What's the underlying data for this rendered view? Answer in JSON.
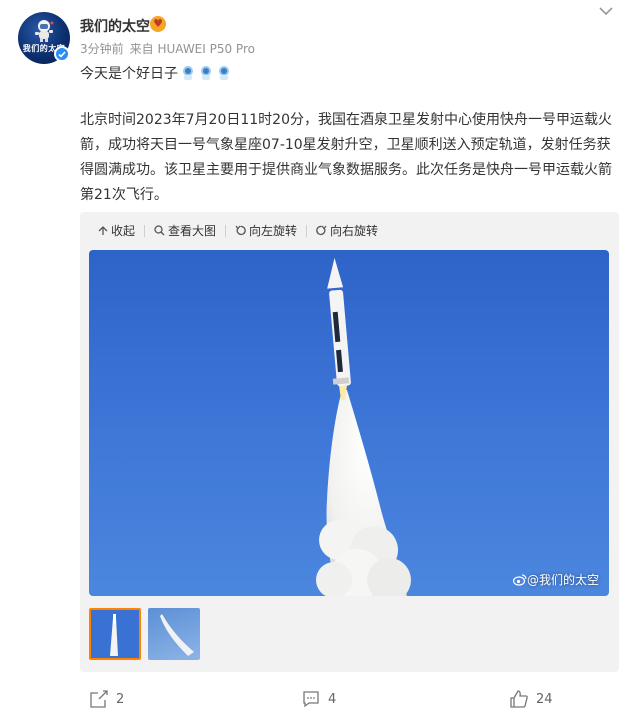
{
  "post": {
    "user_name": "我们的太空",
    "avatar_text": "我们的太空",
    "time_ago": "3分钟前",
    "source": "来自 HUAWEI P50 Pro",
    "status": "今天是个好日子",
    "body": "北京时间2023年7月20日11时20分，我国在酒泉卫星发射中心使用快舟一号甲运载火箭，成功将天目一号气象星座07-10星发射升空，卫星顺利送入预定轨道，发射任务获得圆满成功。该卫星主要用于提供商业气象数据服务。此次任务是快舟一号甲运载火箭第21次飞行。"
  },
  "toolbar": {
    "collapse": "收起",
    "view_large": "查看大图",
    "rotate_left": "向左旋转",
    "rotate_right": "向右旋转"
  },
  "image": {
    "watermark": "@我们的太空"
  },
  "actions": {
    "repost_count": "2",
    "comment_count": "4",
    "like_count": "24"
  },
  "icons": [
    "chevron-down-icon",
    "verified-icon",
    "emoji-icon",
    "collapse-icon",
    "zoom-icon",
    "rotate-left-icon",
    "rotate-right-icon",
    "weibo-logo-icon",
    "share-icon",
    "comment-icon",
    "like-icon"
  ],
  "colors": {
    "accent": "#ff8200",
    "verified": "#2b8ef0",
    "meta": "#939393"
  }
}
